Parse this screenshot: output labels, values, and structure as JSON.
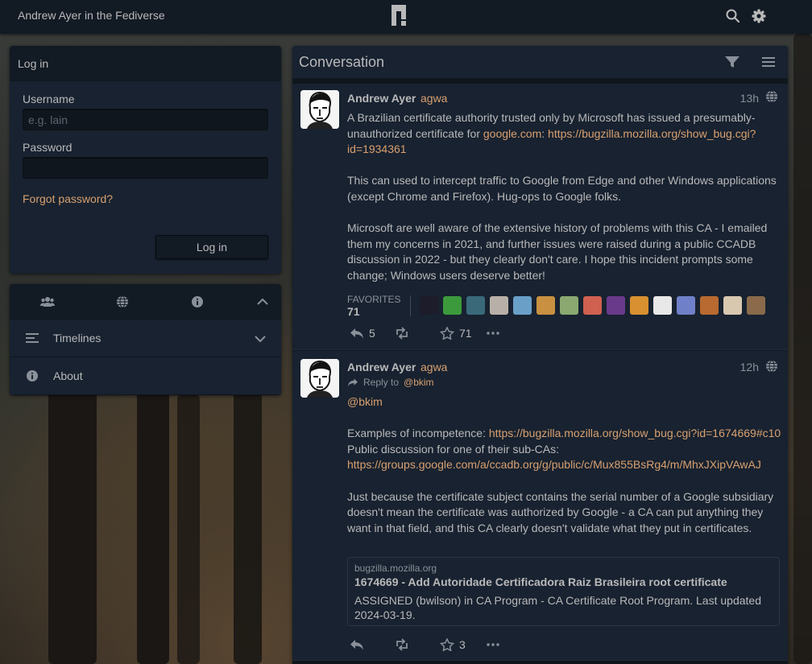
{
  "topbar": {
    "site_title": "Andrew Ayer in the Fediverse",
    "logo_icon": "pleroma-logo-icon",
    "search_icon": "search-icon",
    "settings_icon": "gear-icon"
  },
  "login": {
    "heading": "Log in",
    "username_label": "Username",
    "username_placeholder": "e.g. lain",
    "password_label": "Password",
    "forgot_link": "Forgot password?",
    "submit_label": "Log in"
  },
  "nav": {
    "tabs": [
      "users-icon",
      "globe-icon",
      "info-icon",
      "chevron-up-icon"
    ],
    "items": [
      {
        "label": "Timelines",
        "icon": "menu-icon"
      },
      {
        "label": "About",
        "icon": "info-icon"
      }
    ]
  },
  "conversation": {
    "title": "Conversation",
    "filter_icon": "filter-icon",
    "menu_icon": "menu-icon",
    "statuses": [
      {
        "author_name": "Andrew Ayer",
        "author_handle": "agwa",
        "time": "13h",
        "text_p1_a": "A Brazilian certificate authority trusted only by Microsoft has issued a presumably-unauthorized certificate for ",
        "text_p1_link1": "google.com",
        "text_p1_b": ": ",
        "text_p1_link2": "https://bugzilla.mozilla.org/show_bug.cgi?id=1934361",
        "text_p2": "This can used to intercept traffic to Google from Edge and other Windows applications (except Chrome and Firefox). Hug-ops to Google folks.",
        "text_p3": "Microsoft are well aware of the extensive history of problems with this CA - I emailed them my concerns in 2021, and further issues were raised during a public CCADB discussion in 2022 - but they clearly don't care. I hope this incident prompts some change; Windows users deserve better!",
        "favorites_label": "FAVORITES",
        "favorites_count": "71",
        "replies": "5",
        "stars": "71"
      },
      {
        "author_name": "Andrew Ayer",
        "author_handle": "agwa",
        "time": "12h",
        "reply_to_label": "Reply to",
        "reply_to_handle": "@bkim",
        "mention": "@bkim",
        "examples_label": "Examples of incompetence: ",
        "examples_link": "https://bugzilla.mozilla.org/show_bug.cgi?id=1674669#c10",
        "public_label": "Public discussion for one of their sub-CAs:",
        "public_link": "https://groups.google.com/a/ccadb.org/g/public/c/Mux855BsRg4/m/MhxJXipVAwAJ",
        "text_p3": "Just because the certificate subject contains the serial number of a Google subsidiary doesn't mean the certificate was authorized by Google - a CA can put anything they want in that field, and this CA clearly doesn't validate what they put in certificates.",
        "card_host": "bugzilla.mozilla.org",
        "card_title": "1674669 - Add Autoridade Certificadora Raiz Brasileira root certificate",
        "card_desc": "ASSIGNED (bwilson) in CA Program - CA Certificate Root Program. Last updated 2024-03-19.",
        "stars": "3"
      }
    ]
  },
  "colors": {
    "accent": "#d8a070",
    "panel_bg": "#182230",
    "header_bg": "#121a24",
    "text": "#b9b9ba"
  }
}
